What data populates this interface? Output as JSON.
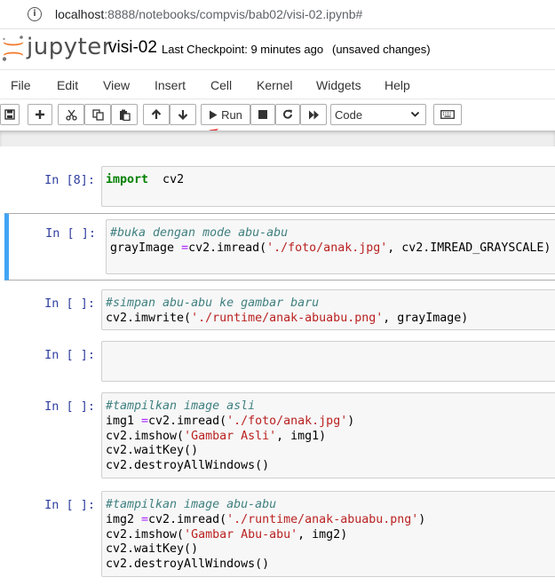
{
  "address_bar": {
    "host": "localhost",
    "path": ":8888/notebooks/compvis/bab02/visi-02.ipynb#"
  },
  "header": {
    "logo_text": "jupyter",
    "notebook_name": "visi-02",
    "checkpoint": "Last Checkpoint: 9 minutes ago",
    "autosave_status": "(unsaved changes)"
  },
  "menu": [
    "File",
    "Edit",
    "View",
    "Insert",
    "Cell",
    "Kernel",
    "Widgets",
    "Help"
  ],
  "toolbar": {
    "run_label": "Run",
    "cell_type": "Code",
    "icons": [
      "save-icon",
      "plus-icon",
      "cut-icon",
      "copy-icon",
      "paste-icon",
      "arrow-up-icon",
      "arrow-down-icon",
      "play-icon",
      "stop-icon",
      "restart-icon",
      "fast-forward-icon",
      "keyboard-icon"
    ]
  },
  "colors": {
    "selected_cell_border": "#42a5f5",
    "prompt": "#303f9f",
    "keyword": "#008000",
    "comment": "#408080",
    "string": "#ba2121",
    "operator": "#aa22ff",
    "annotation_arrow": "#e53935"
  },
  "cells": [
    {
      "prompt": "In [8]:",
      "lines": [
        [
          [
            "kw",
            "import"
          ],
          [
            "",
            "  cv2"
          ]
        ]
      ]
    },
    {
      "prompt": "In [ ]:",
      "lines": [
        [
          [
            "cm",
            "#buka dengan mode abu-abu"
          ]
        ],
        [
          [
            "",
            "grayImage "
          ],
          [
            "op",
            "="
          ],
          [
            "",
            "cv2.imread("
          ],
          [
            "st",
            "'./foto/anak.jpg'"
          ],
          [
            "",
            ", cv2.IMREAD_GRAYSCALE)"
          ]
        ]
      ]
    },
    {
      "prompt": "In [ ]:",
      "lines": [
        [
          [
            "cm",
            "#simpan abu-abu ke gambar baru"
          ]
        ],
        [
          [
            "",
            "cv2.imwrite("
          ],
          [
            "st",
            "'./runtime/anak-abuabu.png'"
          ],
          [
            "",
            ", grayImage)"
          ]
        ]
      ]
    },
    {
      "prompt": "In [ ]:",
      "lines": [
        [
          [
            "",
            ""
          ]
        ]
      ]
    },
    {
      "prompt": "In [ ]:",
      "lines": [
        [
          [
            "cm",
            "#tampilkan image asli"
          ]
        ],
        [
          [
            "",
            "img1 "
          ],
          [
            "op",
            "="
          ],
          [
            "",
            "cv2.imread("
          ],
          [
            "st",
            "'./foto/anak.jpg'"
          ],
          [
            "",
            ")"
          ]
        ],
        [
          [
            "",
            "cv2.imshow("
          ],
          [
            "st",
            "'Gambar Asli'"
          ],
          [
            "",
            ", img1)"
          ]
        ],
        [
          [
            "",
            "cv2.waitKey()"
          ]
        ],
        [
          [
            "",
            "cv2.destroyAllWindows()"
          ]
        ]
      ]
    },
    {
      "prompt": "In [ ]:",
      "lines": [
        [
          [
            "cm",
            "#tampilkan image abu-abu"
          ]
        ],
        [
          [
            "",
            "img2 "
          ],
          [
            "op",
            "="
          ],
          [
            "",
            "cv2.imread("
          ],
          [
            "st",
            "'./runtime/anak-abuabu.png'"
          ],
          [
            "",
            ")"
          ]
        ],
        [
          [
            "",
            "cv2.imshow("
          ],
          [
            "st",
            "'Gambar Abu-abu'"
          ],
          [
            "",
            ", img2)"
          ]
        ],
        [
          [
            "",
            "cv2.waitKey()"
          ]
        ],
        [
          [
            "",
            "cv2.destroyAllWindows()"
          ]
        ]
      ]
    }
  ]
}
